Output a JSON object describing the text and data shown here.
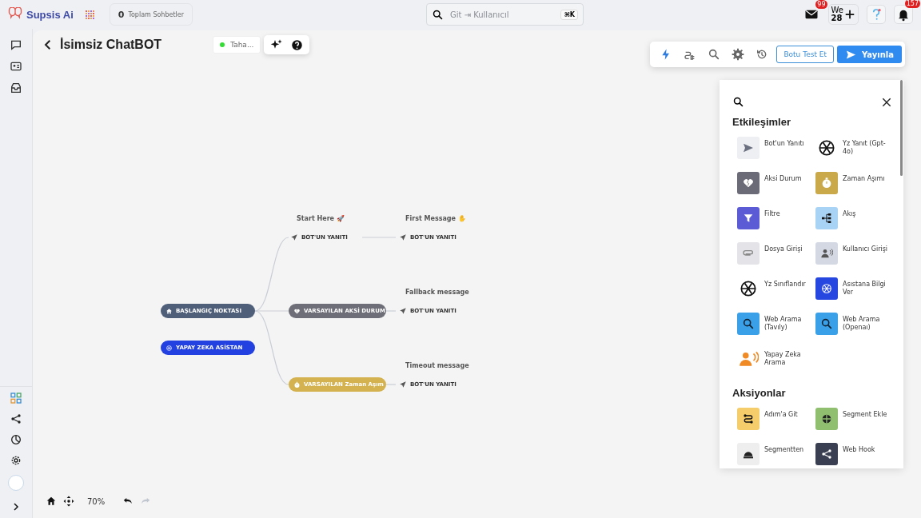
{
  "topbar": {
    "brand": "Supsis Ai",
    "chats": {
      "count": "0",
      "label": "Toplam Sohbetler"
    },
    "search": {
      "placeholder": "Git ⇥ Kullanıcıl",
      "shortcut": "⌘K"
    },
    "mail_badge": "99",
    "date": {
      "day": "We",
      "number": "28"
    },
    "bell_badge": "157"
  },
  "header": {
    "title": "İsimsiz ChatBOT",
    "user": {
      "name": "Taha...",
      "online": true
    }
  },
  "toolbar": {
    "tools": [
      {
        "selected": true
      },
      {
        "selected": false
      },
      {
        "selected": false
      },
      {
        "selected": false
      },
      {
        "selected": false
      }
    ],
    "test_button": "Botu Test Et",
    "publish_button": "Yayınla"
  },
  "flow": {
    "nodes": [
      {
        "kind": "pill",
        "label": "BAŞLANGIÇ NOKTASI",
        "color": "#4f5f7a"
      },
      {
        "kind": "pill",
        "label": "YAPAY ZEKA ASİSTAN",
        "color": "#2340e0"
      },
      {
        "kind": "message",
        "caption": "Start Here 🚀",
        "label": "BOT'UN YANITI"
      },
      {
        "kind": "message",
        "caption": "First Message ✋",
        "label": "BOT'UN YANITI"
      },
      {
        "kind": "pill",
        "label": "VARSAYILAN AKSİ DURUM",
        "color": "#6e6e78"
      },
      {
        "kind": "message",
        "caption": "Fallback message",
        "label": "BOT'UN YANITI"
      },
      {
        "kind": "pill",
        "label": "VARSAYILAN Zaman Aşım",
        "color": "#d4b24f"
      },
      {
        "kind": "message",
        "caption": "Timeout message",
        "label": "BOT'UN YANITI"
      }
    ]
  },
  "palette": {
    "sections": [
      {
        "title": "Etkileşimler",
        "items": [
          {
            "label": "Bot'un Yanıtı",
            "color": "#eeeff2"
          },
          {
            "label": "Yz Yanıt (Gpt-4o)"
          },
          {
            "label": "Aksi Durum",
            "color": "#6b6b78"
          },
          {
            "label": "Zaman Aşımı",
            "color": "#c9a94a"
          },
          {
            "label": "Filtre",
            "color": "#5b5bd6"
          },
          {
            "label": "Akış",
            "color": "#a9d3f5"
          },
          {
            "label": "Dosya Girişi",
            "color": "#e4e4e8"
          },
          {
            "label": "Kullanıcı Girişi",
            "color": "#d4d8e2"
          },
          {
            "label": "Yz Sınıflandır"
          },
          {
            "label": "Asıstana Bilgi Ver",
            "color": "#2748e0"
          },
          {
            "label": "Web Arama (Tavıly)",
            "color": "#3aa0e8"
          },
          {
            "label": "Web Arama (Openaı)",
            "color": "#3aa0e8"
          },
          {
            "label": "Yapay Zeka Arama"
          }
        ]
      },
      {
        "title": "Aksiyonlar",
        "items": [
          {
            "label": "Adım'a Git",
            "color": "#f5cd6a"
          },
          {
            "label": "Segment Ekle",
            "color": "#8fbf6f"
          },
          {
            "label": "Segmentten",
            "color": "#eeeeee"
          },
          {
            "label": "Web Hook",
            "color": "#3a3f52"
          }
        ]
      }
    ]
  },
  "zoom": {
    "level_text": "70%",
    "redo_disabled": true
  }
}
